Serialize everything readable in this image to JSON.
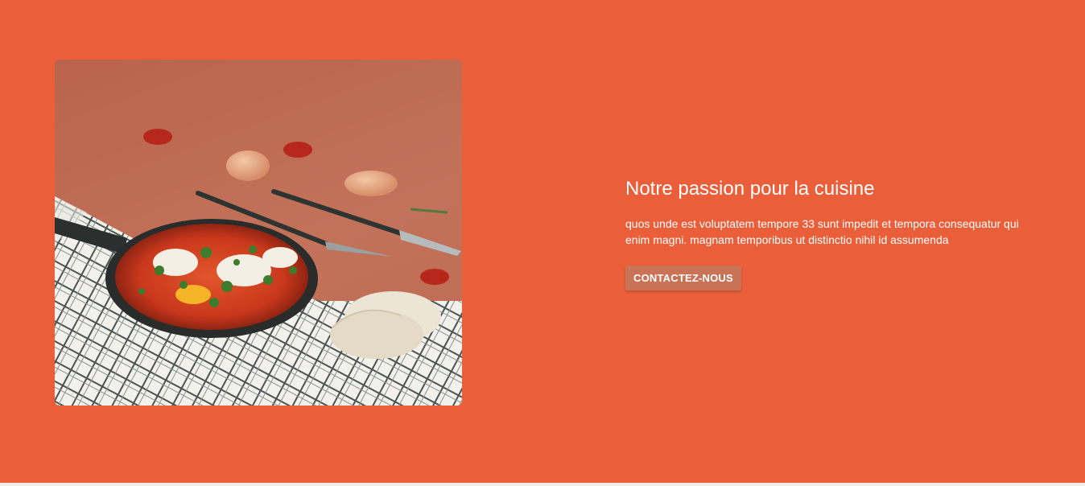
{
  "hero": {
    "title": "Notre passion pour la cuisine",
    "description": "quos unde est voluptatem tempore 33 sunt impedit et tempora consequatur qui enim magni. magnam temporibus ut distinctio nihil id assumenda",
    "cta_label": "CONTACTEZ-NOUS",
    "image_icon": "food-photo-shakshuka"
  },
  "colors": {
    "background": "#ea5f39",
    "button": "#c97356",
    "text": "#ffffff"
  }
}
